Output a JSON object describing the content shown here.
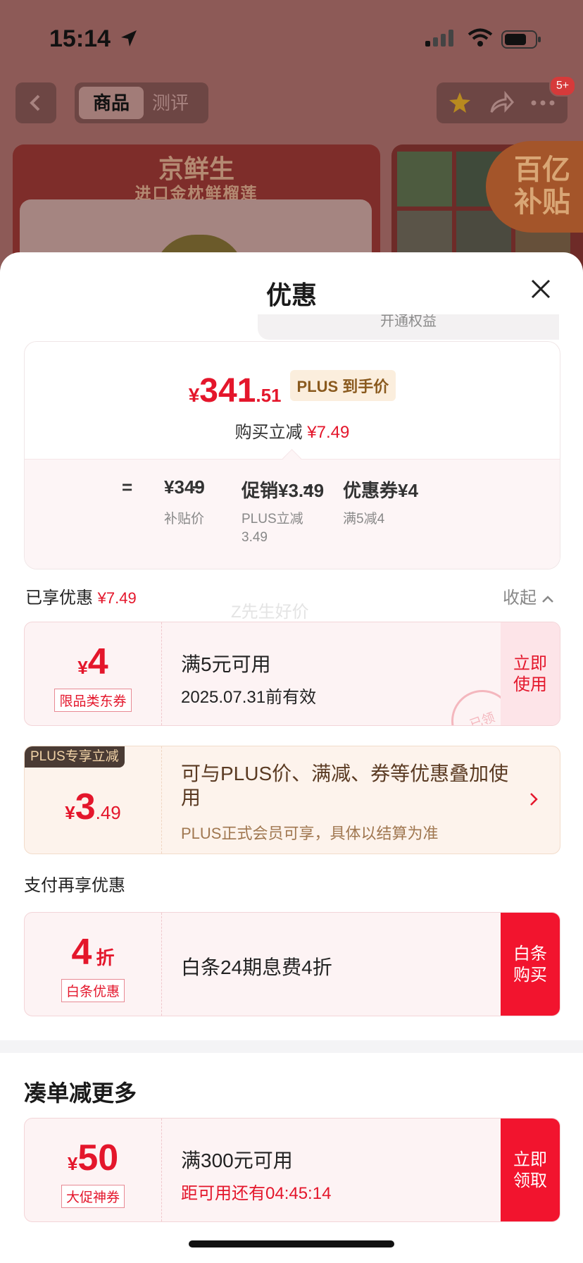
{
  "status_bar": {
    "time": "15:14"
  },
  "top_nav": {
    "tab_active": "商品",
    "tab_inactive": "测评",
    "badge": "5+"
  },
  "background": {
    "banner_brand": "京鲜生",
    "banner_subtitle": "进口金枕鲜榴莲",
    "subsidy_line1": "百亿",
    "subsidy_line2": "补贴"
  },
  "sheet": {
    "title": "优惠",
    "peek_text": "开通权益",
    "price": {
      "currency": "¥",
      "integer": "341",
      "decimal": ".51",
      "tag": "PLUS 到手价",
      "reduce_label": "购买立减",
      "reduce_amount": "¥7.49"
    },
    "breakdown": {
      "equals": "=",
      "minus": "−",
      "items": [
        {
          "main": "¥349",
          "sub": "补贴价"
        },
        {
          "main": "促销¥3.49",
          "sub": "PLUS立减\n3.49"
        },
        {
          "main": "优惠券¥4",
          "sub": "满5减4"
        }
      ]
    },
    "enjoyed": {
      "label": "已享优惠",
      "amount": "¥7.49",
      "collapse": "收起"
    },
    "watermark": "Z先生好价",
    "coupons": [
      {
        "currency": "¥",
        "value": "4",
        "tag": "限品类东券",
        "line1": "满5元可用",
        "line2": "2025.07.31前有效",
        "button": "立即\n使用",
        "stamp": "已领"
      },
      {
        "corner": "PLUS专享立减",
        "currency": "¥",
        "value": "3",
        "decimal": ".49",
        "line1": "可与PLUS价、满减、券等优惠叠加使用",
        "line2": "PLUS正式会员可享，具体以结算为准"
      }
    ],
    "pay_section": {
      "title": "支付再享优惠",
      "coupon": {
        "value": "4",
        "unit": "折",
        "tag": "白条优惠",
        "text": "白条24期息费4折",
        "button": "白条\n购买"
      }
    },
    "more_section": {
      "title": "凑单减更多",
      "coupon": {
        "currency": "¥",
        "value": "50",
        "tag": "大促神券",
        "line1": "满300元可用",
        "line2": "距可用还有04:45:14",
        "button": "立即\n领取"
      }
    }
  },
  "colors": {
    "accent_red": "#e4162b",
    "plus_gold": "#8a5a1e",
    "overlay_bg": "#8d5a57"
  }
}
